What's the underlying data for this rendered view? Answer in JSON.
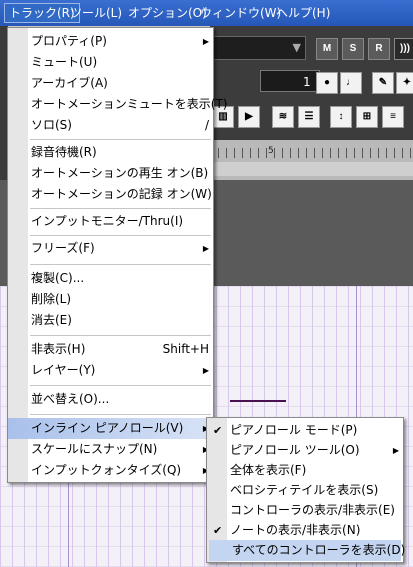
{
  "menubar": {
    "items": [
      "トラック(R)",
      "ツール(L)",
      "オプション(O)",
      "ウィンドウ(W)",
      "ヘルプ(H)"
    ]
  },
  "toolbar": {
    "buttons": [
      "M",
      "S",
      "R"
    ],
    "number_value": "1"
  },
  "ruler": {
    "label": "5"
  },
  "track_menu": {
    "items": [
      {
        "label": "プロパティ(P)",
        "shortcut": "",
        "submenu": true
      },
      {
        "label": "ミュート(U)",
        "shortcut": "",
        "submenu": false
      },
      {
        "label": "アーカイブ(A)",
        "shortcut": "",
        "submenu": false
      },
      {
        "label": "オートメーションミュートを表示(T)",
        "shortcut": "",
        "submenu": false
      },
      {
        "label": "ソロ(S)",
        "shortcut": "/",
        "submenu": false
      },
      {
        "label": "録音待機(R)",
        "shortcut": "",
        "submenu": false
      },
      {
        "label": "オートメーションの再生 オン(B)",
        "shortcut": "",
        "submenu": false
      },
      {
        "label": "オートメーションの記録 オン(W)",
        "shortcut": "",
        "submenu": false
      },
      {
        "label": "インプットモニター/Thru(I)",
        "shortcut": "",
        "submenu": false
      },
      {
        "label": "フリーズ(F)",
        "shortcut": "",
        "submenu": true
      },
      {
        "label": "複製(C)...",
        "shortcut": "",
        "submenu": false
      },
      {
        "label": "削除(L)",
        "shortcut": "",
        "submenu": false
      },
      {
        "label": "消去(E)",
        "shortcut": "",
        "submenu": false
      },
      {
        "label": "非表示(H)",
        "shortcut": "Shift+H",
        "submenu": false
      },
      {
        "label": "レイヤー(Y)",
        "shortcut": "",
        "submenu": true
      },
      {
        "label": "並べ替え(O)...",
        "shortcut": "",
        "submenu": false
      },
      {
        "label": "インライン ピアノロール(V)",
        "shortcut": "",
        "submenu": true
      },
      {
        "label": "スケールにスナップ(N)",
        "shortcut": "",
        "submenu": true
      },
      {
        "label": "インプットクォンタイズ(Q)",
        "shortcut": "",
        "submenu": true
      }
    ]
  },
  "piano_menu": {
    "items": [
      {
        "label": "ピアノロール モード(P)",
        "checked": true,
        "submenu": false
      },
      {
        "label": "ピアノロール ツール(O)",
        "checked": false,
        "submenu": true
      },
      {
        "label": "全体を表示(F)",
        "checked": false,
        "submenu": false
      },
      {
        "label": "ベロシティテイルを表示(S)",
        "checked": false,
        "submenu": false
      },
      {
        "label": "コントローラの表示/非表示(E)",
        "checked": false,
        "submenu": false
      },
      {
        "label": "ノートの表示/非表示(N)",
        "checked": true,
        "submenu": false
      },
      {
        "label": "すべてのコントローラを表示(D)",
        "checked": false,
        "submenu": false
      }
    ]
  },
  "glyphs": {
    "submenu_arrow": "▶",
    "check": "✔",
    "dropdown": "▼"
  },
  "colors": {
    "menubar": "#2457b8",
    "highlight": "#c3d5f0",
    "note": "#4a1050"
  }
}
